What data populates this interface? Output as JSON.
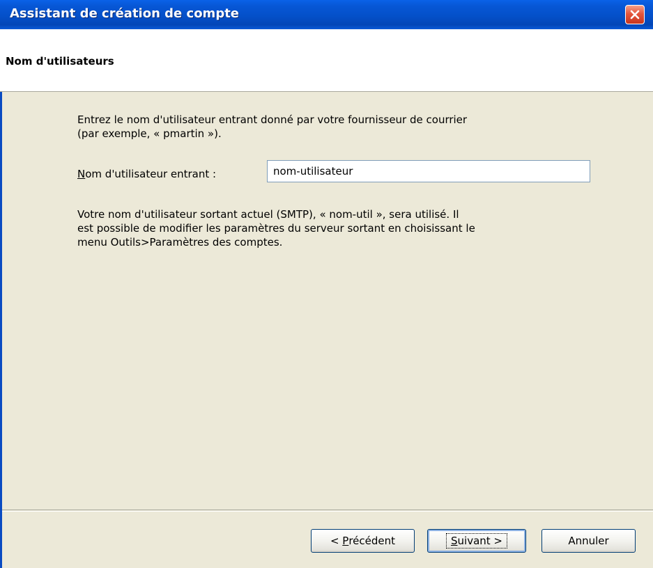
{
  "window": {
    "title": "Assistant de création de compte"
  },
  "page": {
    "title": "Nom d'utilisateurs"
  },
  "content": {
    "intro_line1": "Entrez le nom d'utilisateur entrant donné par votre fournisseur de courrier",
    "intro_line2": "(par exemple, « pmartin »).",
    "field_label_accel": "N",
    "field_label_rest": "om d'utilisateur entrant :",
    "username_value": "nom-utilisateur",
    "smtp_line1": "Votre nom d'utilisateur sortant actuel (SMTP), « nom-util », sera utilisé. Il",
    "smtp_line2": "est possible de modifier les paramètres du serveur sortant en choisissant le",
    "smtp_line3": "menu Outils>Paramètres des comptes."
  },
  "buttons": {
    "prev_prefix": "< ",
    "prev_accel": "P",
    "prev_rest": "récédent",
    "next_accel": "S",
    "next_rest": "uivant >",
    "cancel": "Annuler"
  },
  "colors": {
    "titlebar": "#0450c9",
    "dialog_bg": "#ece9d8",
    "close_button": "#e4563c"
  },
  "icons": {
    "close": "close-icon"
  }
}
